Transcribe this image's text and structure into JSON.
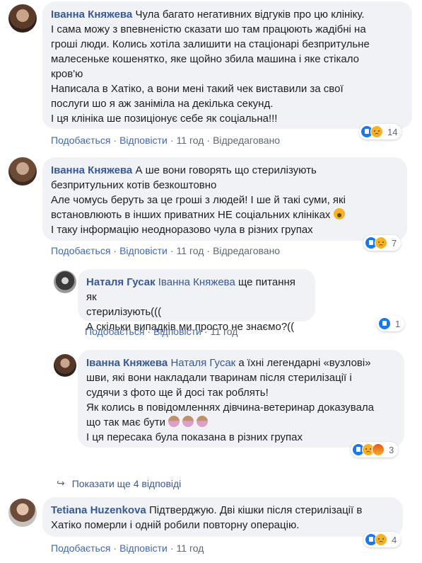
{
  "comments": [
    {
      "author": "Іванна Княжева",
      "lines": [
        "Чула багато негативних відгуків про цю клініку.",
        "І сама можу з впевненістю сказати шо там працюють жадібні на",
        "гроші люди. Колись хотіла залишити на стаціонарі безпритульне",
        "малесеньке кошенятко, яке щойно збила машина і яке стікало",
        "кров'ю",
        "Написала в Хатіко, а вони мені такий чек виставили за свої",
        "послуги шо я аж заніміла на декілька секунд.",
        "І ця клініка ше позиціонує себе як соціальна!!!"
      ],
      "like": "Подобається",
      "reply": "Відповісти",
      "time": "11 год",
      "edited": "Відредаговано",
      "reaction_count": "14"
    },
    {
      "author": "Іванна Княжева",
      "lines": [
        "А ше вони говорять що стерилізують",
        "безпритульних котів безкоштовно",
        "Але чомусь беруть за це гроші з людей! І ше й такі суми, які",
        "встановлюють в інших приватних НЕ соціальних клініках",
        "І таку інформацію неодноразово чула в різних групах"
      ],
      "like": "Подобається",
      "reply": "Відповісти",
      "time": "11 год",
      "edited": "Відредаговано",
      "reaction_count": "7"
    },
    {
      "author": "Наталя Гусак",
      "mention": "Іванна Княжева",
      "lines": [
        "ще питання як",
        "стерилізують(((",
        "А скільки випадків ми просто не знаємо?(("
      ],
      "like": "Подобається",
      "reply": "Відповісти",
      "time": "11 год",
      "reaction_count": "1"
    },
    {
      "author": "Іванна Княжева",
      "mention": "Наталя Гусак",
      "lines": [
        "а їхні легендарні «вузлові»",
        "шви, які вони накладали тваринам після стерилізації і",
        "судячи з фото ще й досі так роблять!",
        "Як колись в повідомленнях дівчина-ветеринар доказувала",
        "що так має бути",
        "І ця пересака була показана в різних групах"
      ],
      "like": "Подобається",
      "reply": "Відповісти",
      "time": "11 год",
      "reaction_count": "3"
    },
    {
      "author": "Tetiana Huzenkova",
      "lines": [
        "Підтверджую. Дві кішки після стерилізації в",
        "Хатіко померли і одній робили повторну операцію."
      ],
      "like": "Подобається",
      "reply": "Відповісти",
      "time": "11 год",
      "reaction_count": "4"
    }
  ],
  "show_more": "Показати ще 4 відповіді",
  "reaction_colors": {
    "like": "#1877f2",
    "sad": "#f7b125",
    "angry": "#e9531f"
  },
  "link_color": "#385898"
}
